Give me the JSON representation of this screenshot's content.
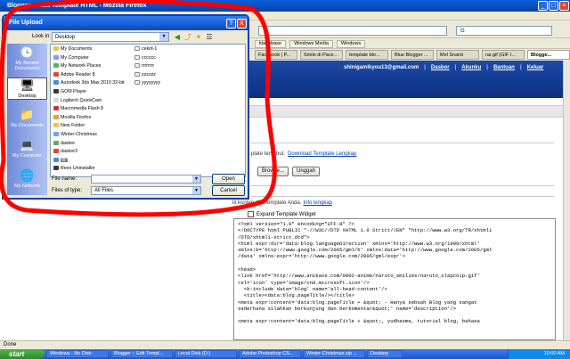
{
  "window": {
    "title": "Blogger :: Edit Template HTML - Mozilla Firefox"
  },
  "menu": {
    "items": [
      "File",
      "Edit",
      "View",
      "History",
      "Bookmarks",
      "Tools",
      "Help"
    ]
  },
  "search": {
    "engine": "G"
  },
  "bookmarks": [
    "ktacebase",
    "Windows Media",
    "Windows"
  ],
  "tabs": [
    {
      "label": "Facebook | P..."
    },
    {
      "label": "Smile di Pace..."
    },
    {
      "label": "template blo..."
    },
    {
      "label": "Blue Blogger ..."
    },
    {
      "label": "Mel Snanti"
    },
    {
      "label": "rar.gif (GIF I..."
    },
    {
      "label": "Blogge..."
    }
  ],
  "blogger": {
    "user": "shinigamikyou13@gmail.com",
    "links": [
      "Dasbor",
      "Akunku",
      "Bantuan",
      "Keluar"
    ]
  },
  "page": {
    "download_text": "plate tersebut.",
    "download_link": "Download Template Lengkap",
    "browse_label": "Browse...",
    "upload_label": "Unggah",
    "edit_text": "lit konten dari template Anda.",
    "edit_link": "Info lengkap",
    "expand_label": "Expand Template Widget",
    "code_lines": [
      "<?xml version=\"1.0\" encoding=\"UTF-8\" ?>",
      "<!DOCTYPE html PUBLIC \"-//W3C//DTD XHTML 1.0 Strict//EN\" \"http://www.w3.org/TR/xhtml1",
      "/DTD/xhtml1-strict.dtd\">",
      "<html expr:dir='data:blog.languageDirection' xmlns='http://www.w3.org/1999/xhtml'",
      "xmlns:b='http://www.google.com/2005/gml/b' xmlns:data='http://www.google.com/2005/gml",
      "/data' xmlns:expr='http://www.google.com/2005/gml/expr'>",
      "",
      "<head>",
      "<link href='http://www.anikaos.com/0002-anime/naruto_smilies/naruto_olapcoip.gif'",
      "rel='icon' type='image/vnd.microsoft.icon'/>",
      "  <b:include data='blog' name='all-head-content'/>",
      "  <title><data:blog.pageTitle/></title>",
      "<meta expr:content='data:blog.pageTitle + &quot; - Hanya sebuah Blog yang sangat",
      "sederhana silahkan berkunjung dan berkomentar&quot;' name='description'/>",
      "",
      "<meta expr:content='data:blog.pageTitle + &quot;, yudhasme, tutorial blog, bahasa"
    ],
    "status": "Done"
  },
  "dialog": {
    "title": "File Upload",
    "help": "?",
    "close": "X",
    "lookin_label": "Look in:",
    "lookin_value": "Desktop",
    "places": [
      "My Recent Documents",
      "Desktop",
      "My Documents",
      "My Computer",
      "My Network"
    ],
    "files_col1": [
      "My Documents",
      "My Computer",
      "My Network Places",
      "Adobe Reader 8",
      "Autodesk 3ds Max 2010 32-bit",
      "GOM Player",
      "Logitech QuickCam",
      "Macromedia Flash 8",
      "Mozilla Firefox",
      "New Folder",
      "Winter-Christmas",
      "dasbor",
      "dasbor2",
      "jjjjjjj",
      "Revo Uninstaller"
    ],
    "files_col2": [
      "cekot-1",
      "cccccc",
      "rrrrrrrr",
      "zzzzzz",
      "yyyyyyyy"
    ],
    "filename_label": "File name:",
    "filename_value": "",
    "filetype_label": "Files of type:",
    "filetype_value": "All Files",
    "open_label": "Open",
    "cancel_label": "Cancel"
  },
  "taskbar": {
    "start": "start",
    "tasks": [
      "Windows - No Disk",
      "Blogger :: Edit Templ...",
      "Local Disk (D:)",
      "Adobe Photoshop CS...",
      "Winter-Christmas.zip ...",
      "Desktop"
    ],
    "clock": "10:00 AM"
  },
  "colors": {
    "annotation": "#ff0000",
    "titlebar": "#0b48c4",
    "blogger_header": "#1d4aa8",
    "link": "#0645ad"
  }
}
